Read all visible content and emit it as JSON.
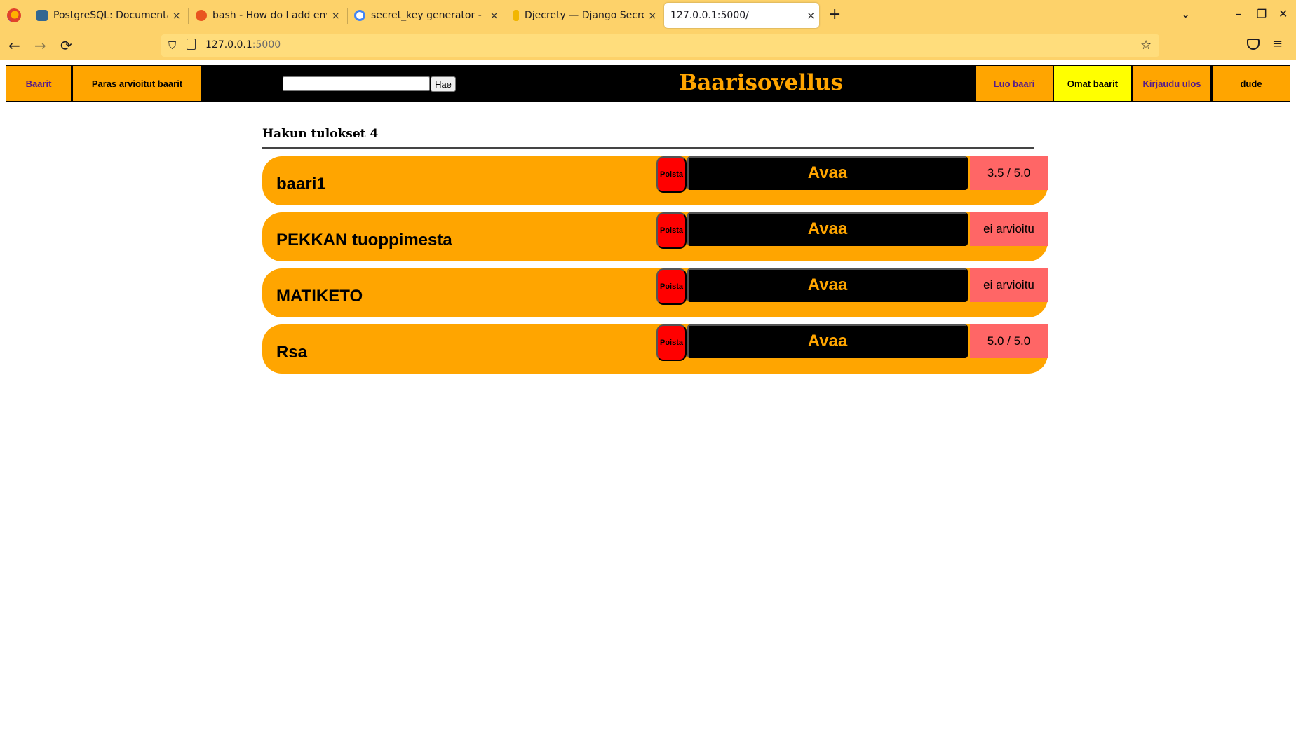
{
  "browser": {
    "tabs": [
      {
        "title": "PostgreSQL: Documentat",
        "favicon": "elephant-icon",
        "close": "×"
      },
      {
        "title": "bash - How do I add envir",
        "favicon": "askubuntu-icon",
        "close": "×"
      },
      {
        "title": "secret_key generator - Go",
        "favicon": "google-icon",
        "close": "×"
      },
      {
        "title": "Djecrety — Django Secre",
        "favicon": "key-icon",
        "close": "×"
      },
      {
        "title": "127.0.0.1:5000/",
        "favicon": "",
        "close": "×"
      }
    ],
    "new_tab": "+",
    "tab_list": "⌄",
    "window_controls": {
      "minimize": "–",
      "restore": "❐",
      "close": "✕"
    },
    "nav": {
      "back": "←",
      "forward": "→",
      "reload": "⟳"
    },
    "url": {
      "host": "127.0.0.1",
      "port": ":5000"
    },
    "bookmark": "☆",
    "menu": "≡"
  },
  "site": {
    "nav": {
      "bars": "Baarit",
      "top_rated": "Paras arvioitut baarit",
      "search_button": "Hae",
      "search_value": "",
      "title": "Baarisovellus",
      "create_bar": "Luo baari",
      "my_bars": "Omat baarit",
      "logout": "Kirjaudu ulos",
      "user": "dude"
    },
    "results_heading": "Hakun tulokset 4",
    "bars": [
      {
        "name": "baari1",
        "delete_label": "Poista",
        "open_label": "Avaa",
        "rating": "3.5 / 5.0"
      },
      {
        "name": "PEKKAN tuoppimesta",
        "delete_label": "Poista",
        "open_label": "Avaa",
        "rating": "ei arvioitu"
      },
      {
        "name": "MATIKETO",
        "delete_label": "Poista",
        "open_label": "Avaa",
        "rating": "ei arvioitu"
      },
      {
        "name": "Rsa",
        "delete_label": "Poista",
        "open_label": "Avaa",
        "rating": "5.0 / 5.0"
      }
    ],
    "colors": {
      "accent": "#ffa500",
      "nav_bg": "#000000",
      "highlight": "#ffff00",
      "delete": "#ff0000",
      "rating_bg": "#ff6666"
    }
  }
}
